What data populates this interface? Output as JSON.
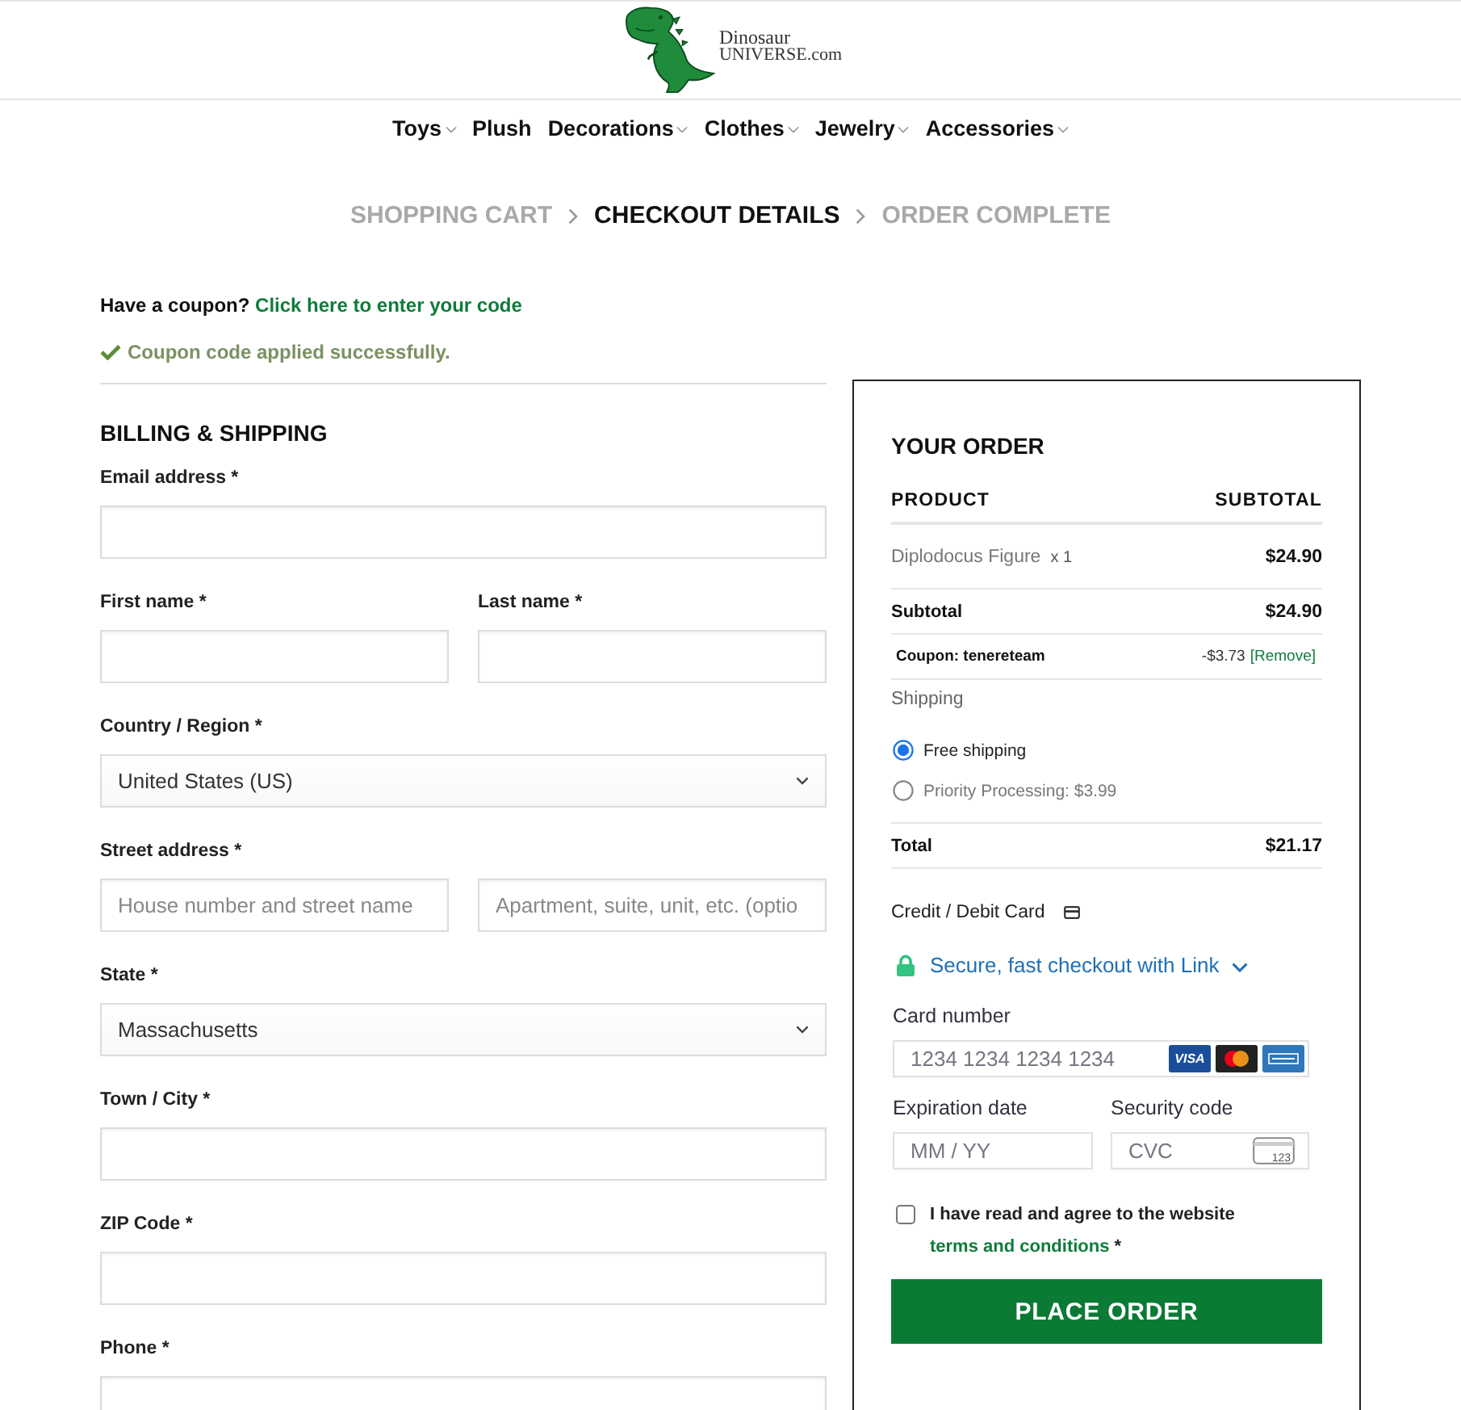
{
  "header": {
    "logo": {
      "line_1": "Dinosaur",
      "line_2": "UNIVERSE.com"
    }
  },
  "nav": [
    {
      "label": "Toys",
      "dropdown": true
    },
    {
      "label": "Plush",
      "dropdown": false
    },
    {
      "label": "Decorations",
      "dropdown": true
    },
    {
      "label": "Clothes",
      "dropdown": true
    },
    {
      "label": "Jewelry",
      "dropdown": true
    },
    {
      "label": "Accessories",
      "dropdown": true
    }
  ],
  "steps": [
    {
      "label": "SHOPPING CART",
      "selected": false
    },
    {
      "label": "CHECKOUT DETAILS",
      "selected": true
    },
    {
      "label": "ORDER COMPLETE",
      "selected": false
    }
  ],
  "coupon": {
    "prompt": "Have a coupon?",
    "link": "Click here to enter your code",
    "notice": "Coupon code applied successfully."
  },
  "billing": {
    "title": "BILLING & SHIPPING",
    "rows": [
      {
        "fields": [
          {
            "label": "Email address *",
            "kind": "text"
          }
        ]
      },
      {
        "fields": [
          {
            "label": "First name *",
            "kind": "text"
          },
          {
            "label": "Last name *",
            "kind": "text"
          }
        ]
      },
      {
        "fields": [
          {
            "label": "Country / Region *",
            "kind": "select",
            "value": "United States (US)"
          }
        ]
      },
      {
        "label": "Street address *",
        "fields": [
          {
            "kind": "text",
            "placeholder": "House number and street name"
          },
          {
            "kind": "text",
            "placeholder": "Apartment, suite, unit, etc. (optio"
          }
        ]
      },
      {
        "fields": [
          {
            "label": "State *",
            "kind": "select",
            "value": "Massachusetts"
          }
        ]
      },
      {
        "fields": [
          {
            "label": "Town / City *",
            "kind": "text"
          }
        ]
      },
      {
        "fields": [
          {
            "label": "ZIP Code *",
            "kind": "text"
          }
        ]
      },
      {
        "fields": [
          {
            "label": "Phone *",
            "kind": "text"
          }
        ]
      }
    ]
  },
  "order": {
    "title": "YOUR ORDER",
    "columns": [
      "PRODUCT",
      "SUBTOTAL"
    ],
    "items": [
      {
        "name": "Diplodocus Figure",
        "quantity": "x 1",
        "price": "$24.90"
      }
    ],
    "subtotal": {
      "label": "Subtotal",
      "value": "$24.90"
    },
    "discount": {
      "label": "Coupon: tenereteam",
      "amount": "-$3.73",
      "remove": "[Remove]"
    },
    "shipping": {
      "label": "Shipping",
      "options": [
        {
          "label": "Free shipping",
          "selected": true
        },
        {
          "label": "Priority Processing: $3.99",
          "selected": false
        }
      ]
    },
    "total": {
      "label": "Total",
      "value": "$21.17"
    }
  },
  "payment": {
    "method": "Credit / Debit Card",
    "link_offer": "Secure, fast checkout with Link",
    "card_number": {
      "label": "Card number",
      "placeholder": "1234 1234 1234 1234",
      "brands": [
        {
          "kind": "visa",
          "label": "VISA"
        },
        {
          "kind": "mastercard"
        },
        {
          "kind": "amex"
        }
      ]
    },
    "expiry": {
      "label": "Expiration date",
      "placeholder": "MM / YY"
    },
    "cvc": {
      "label": "Security code",
      "placeholder": "CVC",
      "hint": "123"
    }
  },
  "terms": {
    "checked": false,
    "text": "I have read and agree to the website",
    "link": "terms and conditions",
    "mark": "*"
  },
  "place_order": "PLACE ORDER"
}
